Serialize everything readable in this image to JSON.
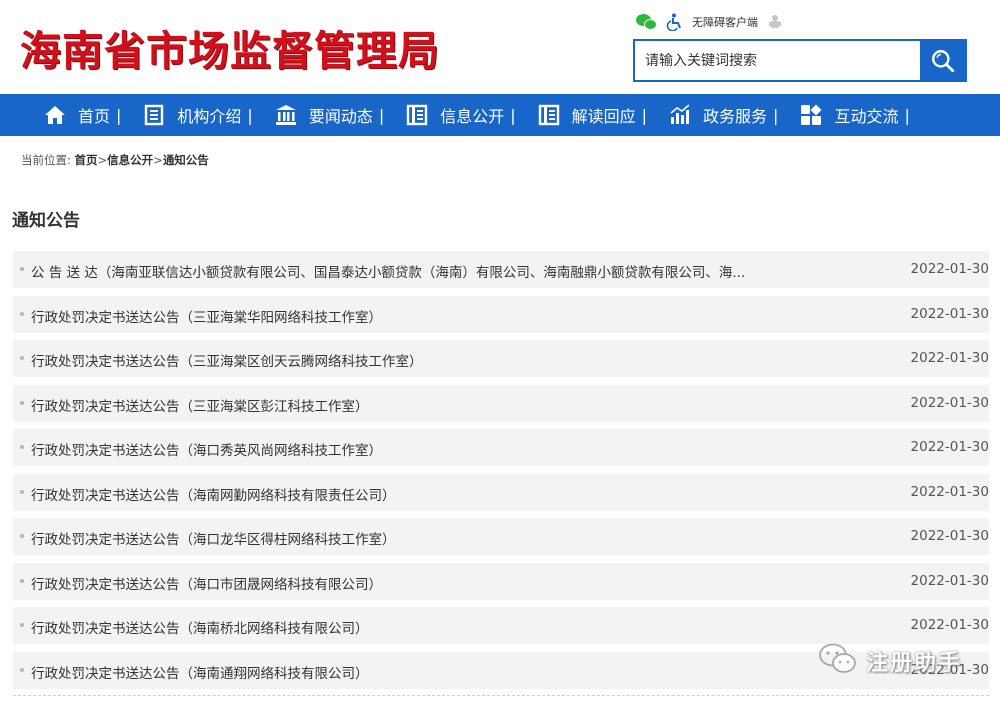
{
  "header": {
    "site_title": "海南省市场监督管理局",
    "tools": {
      "accessibility_label": "无障碍客户端"
    },
    "search": {
      "placeholder": "请输入关键词搜索"
    }
  },
  "nav": {
    "separator": "|",
    "items": [
      {
        "label": "首页",
        "icon": "home-icon"
      },
      {
        "label": "机构介绍",
        "icon": "document-icon"
      },
      {
        "label": "要闻动态",
        "icon": "building-icon"
      },
      {
        "label": "信息公开",
        "icon": "book-icon"
      },
      {
        "label": "解读回应",
        "icon": "book-icon"
      },
      {
        "label": "政务服务",
        "icon": "chart-icon"
      },
      {
        "label": "互动交流",
        "icon": "grid-icon"
      }
    ]
  },
  "breadcrumb": {
    "prefix": "当前位置:",
    "separator": ">",
    "items": [
      "首页",
      "信息公开",
      "通知公告"
    ]
  },
  "section": {
    "title": "通知公告"
  },
  "notices": [
    {
      "title": "公 告 送 达（海南亚联信达小额贷款有限公司、国昌泰达小额贷款（海南）有限公司、海南融鼎小额贷款有限公司、海...",
      "date": "2022-01-30"
    },
    {
      "title": "行政处罚决定书送达公告（三亚海棠华阳网络科技工作室）",
      "date": "2022-01-30"
    },
    {
      "title": "行政处罚决定书送达公告（三亚海棠区创天云腾网络科技工作室）",
      "date": "2022-01-30"
    },
    {
      "title": "行政处罚决定书送达公告（三亚海棠区彭江科技工作室）",
      "date": "2022-01-30"
    },
    {
      "title": "行政处罚决定书送达公告（海口秀英风尚网络科技工作室）",
      "date": "2022-01-30"
    },
    {
      "title": "行政处罚决定书送达公告（海南网勤网络科技有限责任公司）",
      "date": "2022-01-30"
    },
    {
      "title": "行政处罚决定书送达公告（海口龙华区得柱网络科技工作室）",
      "date": "2022-01-30"
    },
    {
      "title": "行政处罚决定书送达公告（海口市团晟网络科技有限公司）",
      "date": "2022-01-30"
    },
    {
      "title": "行政处罚决定书送达公告（海南桥北网络科技有限公司）",
      "date": "2022-01-30"
    },
    {
      "title": "行政处罚决定书送达公告（海南通翔网络科技有限公司）",
      "date": "2022-01-30"
    }
  ],
  "watermark": {
    "text": "注册助手"
  },
  "colors": {
    "brand_red": "#d0101b",
    "brand_blue": "#1866c8",
    "row_bg": "#f3f3f3"
  }
}
